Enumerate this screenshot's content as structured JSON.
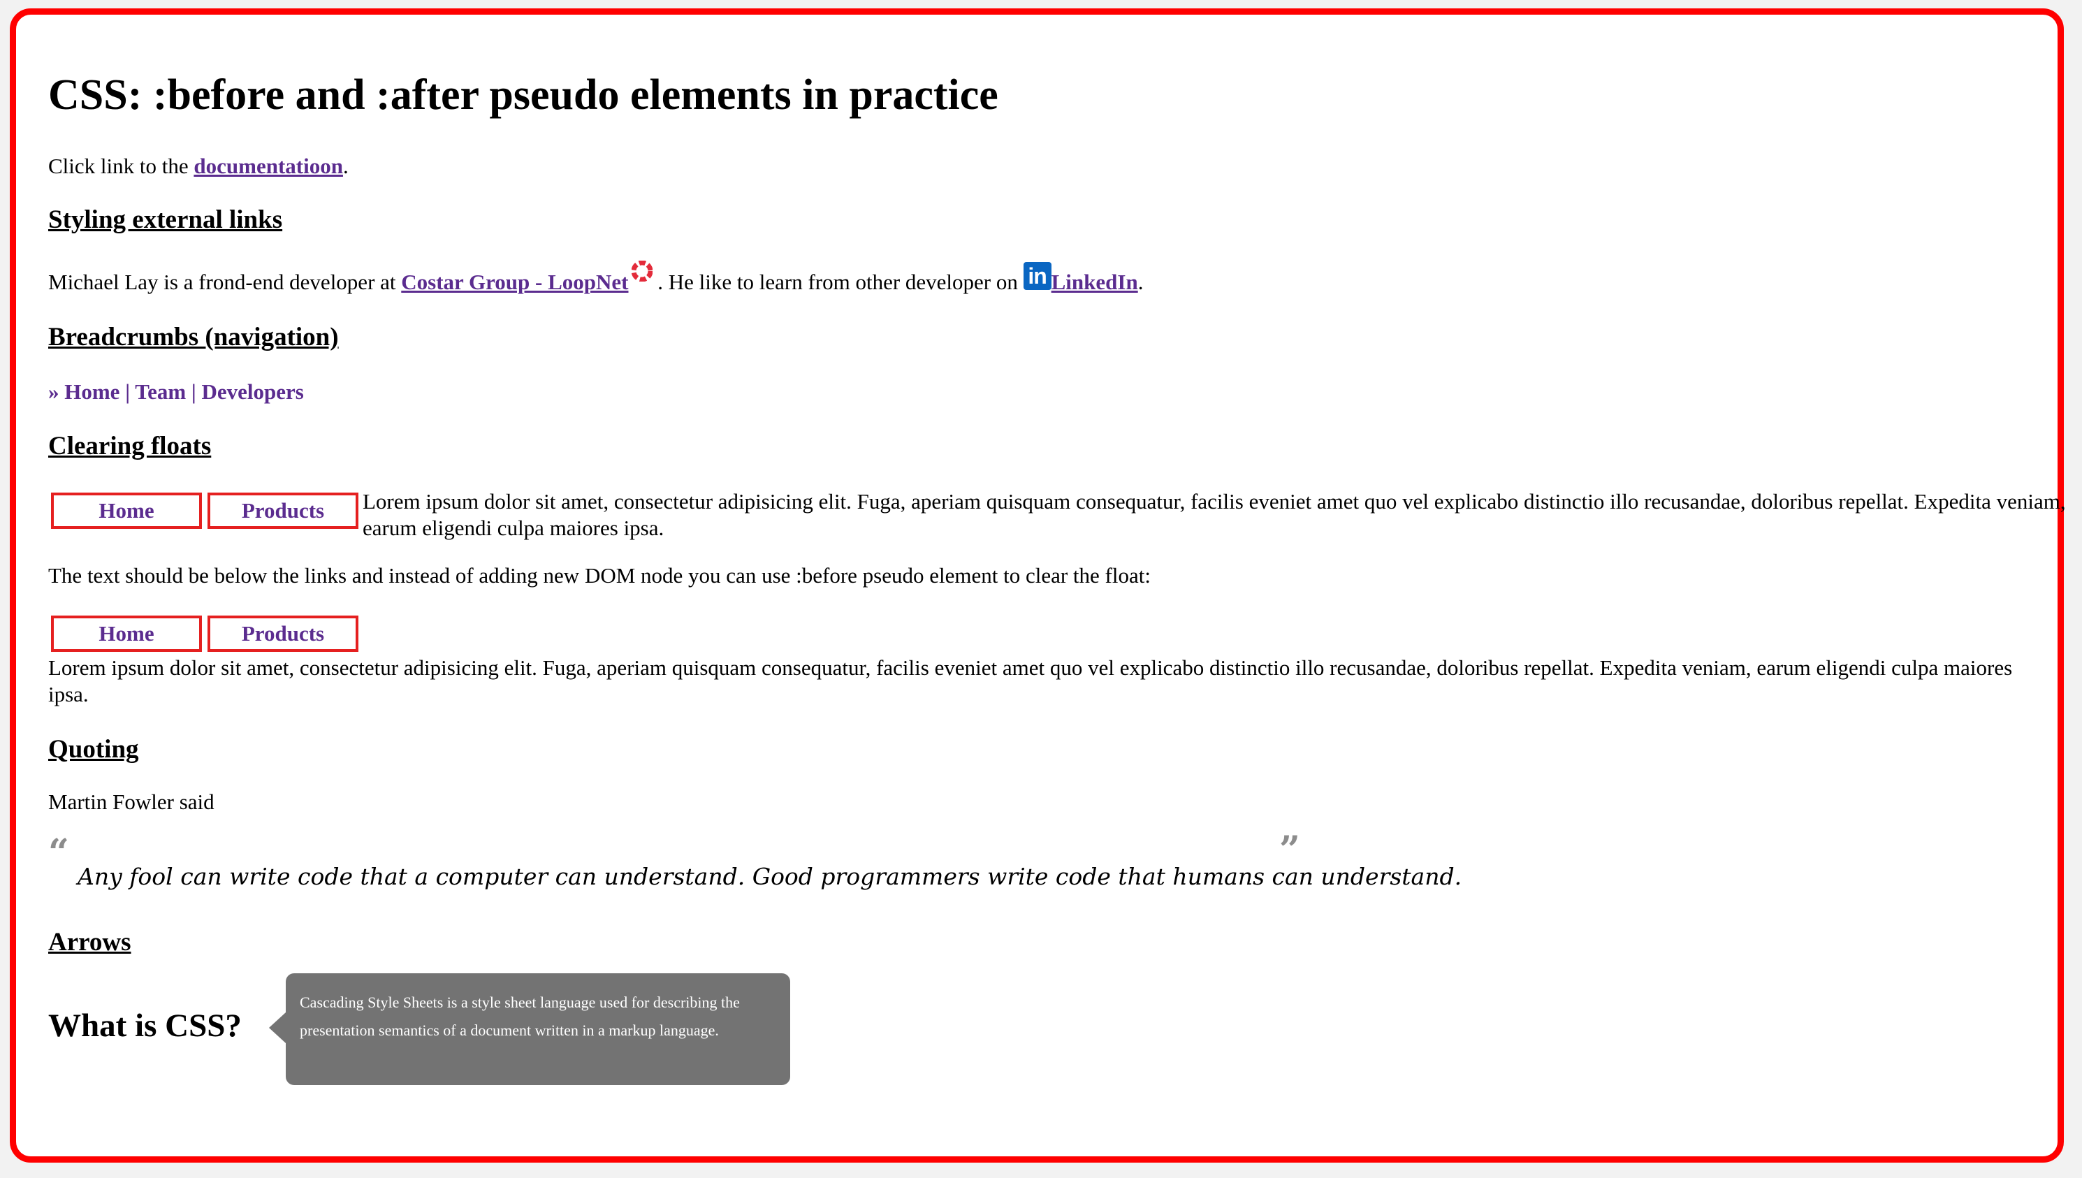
{
  "title": "CSS: :before and :after pseudo elements in practice",
  "intro": {
    "prefix": "Click link to the ",
    "link": "documentatioon",
    "suffix": "."
  },
  "external_links": {
    "heading": "Styling external links",
    "text_1": "Michael Lay is a frond-end developer at ",
    "link_1": "Costar Group - LoopNet",
    "text_2": " . He like to learn from other developer on ",
    "link_2_icon": "in",
    "link_2": "LinkedIn",
    "text_3": "."
  },
  "breadcrumbs": {
    "heading": "Breadcrumbs (navigation)",
    "prefix": "» ",
    "items": [
      "Home",
      "Team",
      "Developers"
    ],
    "separator": " | "
  },
  "floats": {
    "heading": "Clearing floats",
    "nav_1": [
      "Home",
      "Products"
    ],
    "lorem_1": "Lorem ipsum dolor sit amet, consectetur adipisicing elit. Fuga, aperiam quisquam consequatur, facilis eveniet amet quo vel explicabo distinctio illo recusandae, doloribus repellat. Expedita veniam, earum eligendi culpa maiores ipsa.",
    "explain": "The text should be below the links and instead of adding new DOM node you can use :before pseudo element to clear the float:",
    "nav_2": [
      "Home",
      "Products"
    ],
    "lorem_2": "Lorem ipsum dolor sit amet, consectetur adipisicing elit. Fuga, aperiam quisquam consequatur, facilis eveniet amet quo vel explicabo distinctio illo recusandae, doloribus repellat. Expedita veniam, earum eligendi culpa maiores ipsa."
  },
  "quoting": {
    "heading": "Quoting",
    "author_line": "Martin Fowler said",
    "open_mark": "“",
    "close_mark": "”",
    "quote": "Any fool can write code that a computer can understand. Good programmers write code that humans can understand."
  },
  "arrows": {
    "heading": "Arrows",
    "question": "What is CSS?",
    "tooltip": "Cascading Style Sheets is a style sheet language used for describing the presentation semantics of a document written in a markup language."
  },
  "colors": {
    "frame_border": "#ff0000",
    "link": "#5b2c8f",
    "nav_border": "#e52020",
    "tooltip_bg": "#737373",
    "linkedin": "#0a66c2",
    "loopnet_icon": "#e32b3a"
  }
}
